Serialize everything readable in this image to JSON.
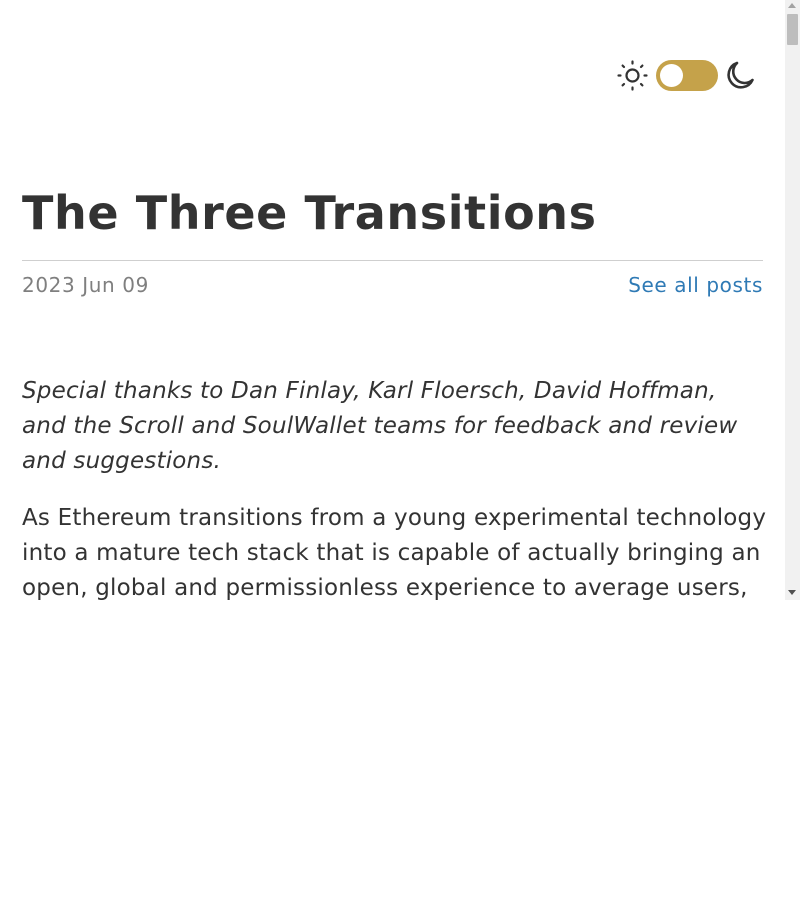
{
  "theme": {
    "light_icon": "sun-icon",
    "dark_icon": "moon-icon",
    "toggle_color": "#c5a24a"
  },
  "post": {
    "title": "The Three Transitions",
    "date": "2023 Jun 09",
    "all_posts_link": "See all posts",
    "thanks": "Special thanks to Dan Finlay, Karl Floersch, David Hoffman, and the Scroll and SoulWallet teams for feedback and review and suggestions.",
    "intro": "As Ethereum transitions from a young experimental technology into a mature tech stack that is capable of actually bringing an open, global and permissionless experience to average users, there are"
  },
  "colors": {
    "text": "#333333",
    "muted": "#7f7f7f",
    "link": "#2f7ab5"
  }
}
